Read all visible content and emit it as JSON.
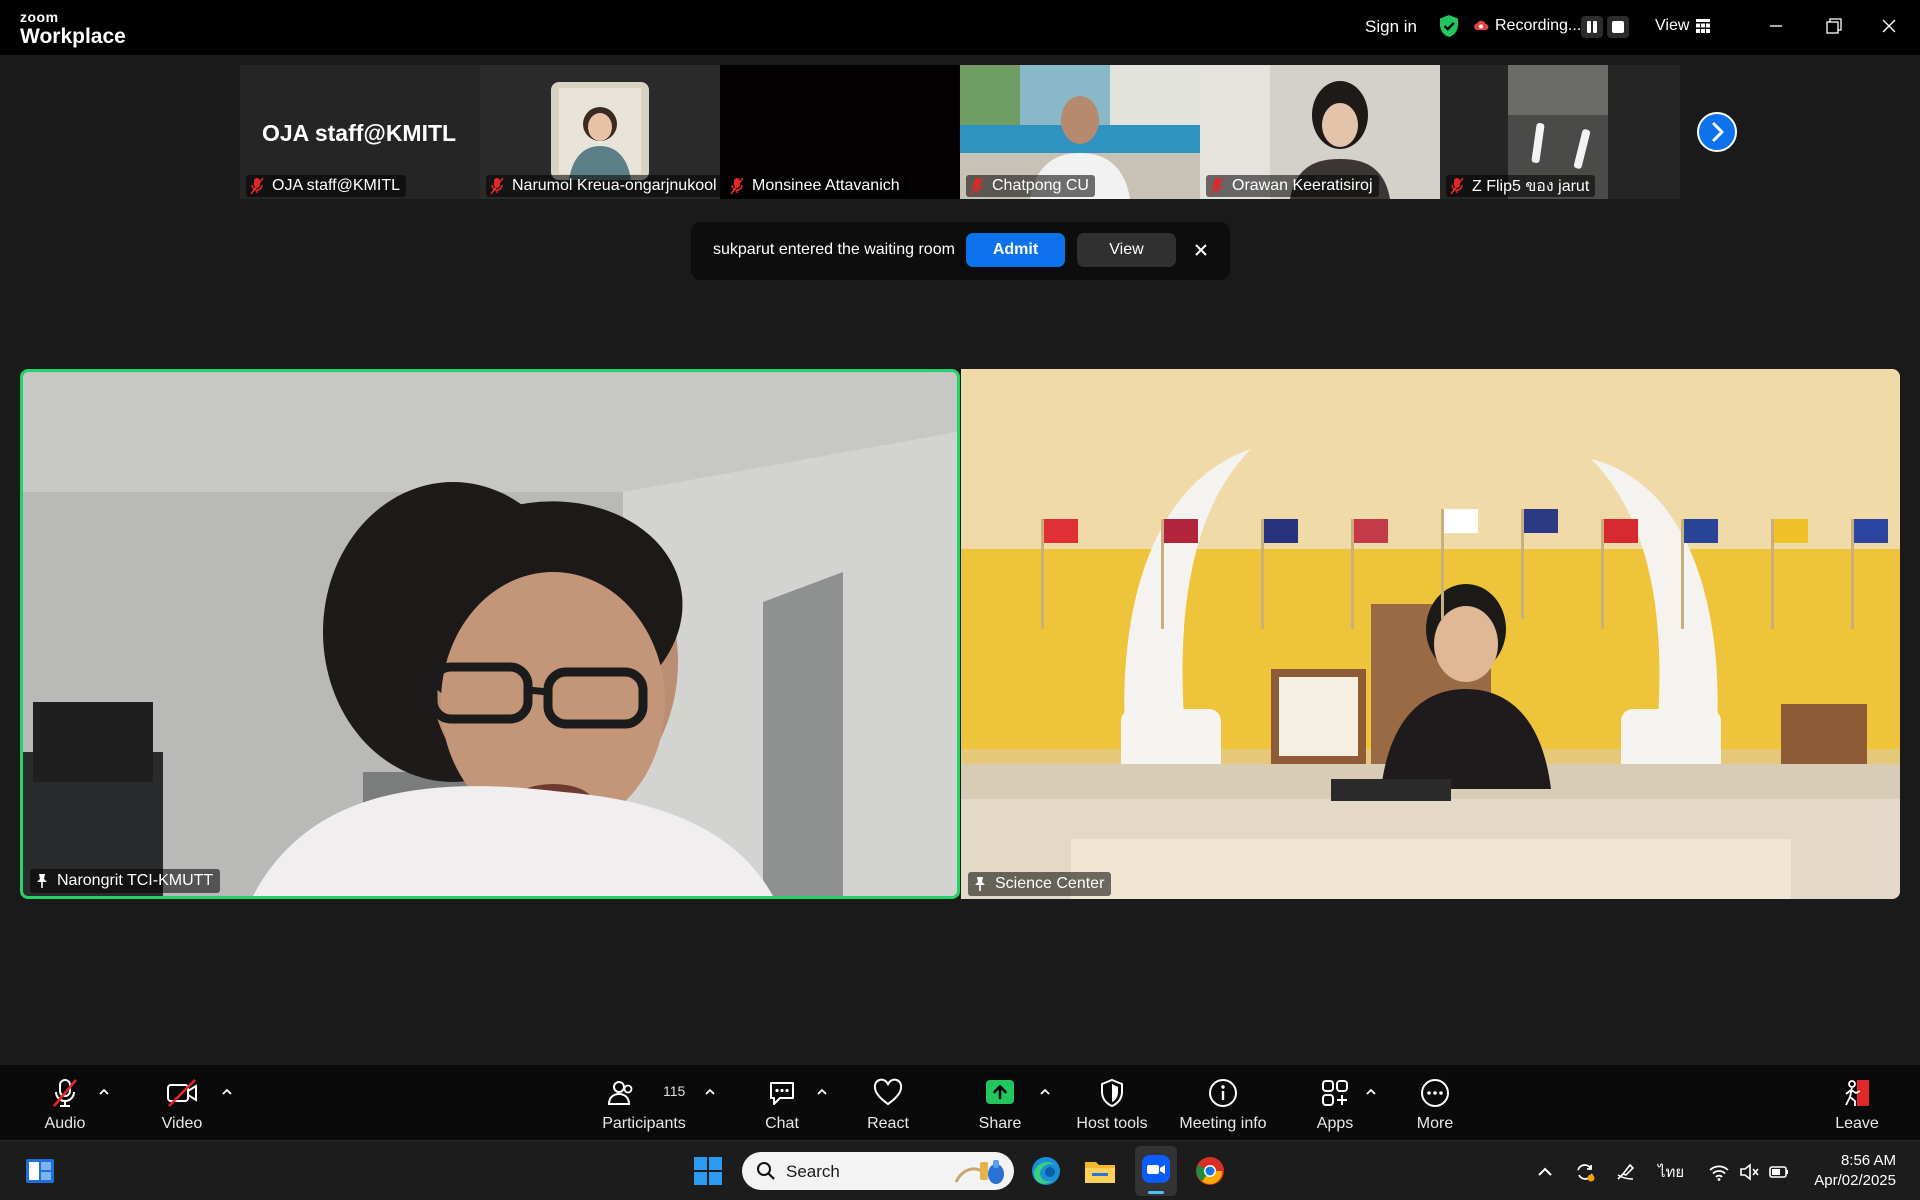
{
  "app": {
    "logo_top": "zoom",
    "logo_bottom": "Workplace",
    "sign_in": "Sign in",
    "recording_label": "Recording...",
    "view_label": "View"
  },
  "thumbnails": [
    {
      "name": "OJA staff@KMITL",
      "tile_text": "OJA staff@KMITL",
      "muted": true
    },
    {
      "name": "Narumol Kreua-ongarjnukool",
      "muted": true
    },
    {
      "name": "Monsinee Attavanich",
      "muted": true
    },
    {
      "name": "Chatpong CU",
      "muted": true
    },
    {
      "name": "Orawan Keeratisiroj",
      "muted": true
    },
    {
      "name": "Z Flip5 ของ jarut",
      "muted": true
    }
  ],
  "notification": {
    "text": "sukparut entered the waiting room",
    "admit_label": "Admit",
    "view_label": "View"
  },
  "main_videos": [
    {
      "name": "Narongrit TCI-KMUTT",
      "active_speaker": true
    },
    {
      "name": "Science Center",
      "active_speaker": false
    }
  ],
  "toolbar": {
    "audio": "Audio",
    "video": "Video",
    "participants": "Participants",
    "participants_count": "115",
    "chat": "Chat",
    "react": "React",
    "share": "Share",
    "host_tools": "Host tools",
    "meeting_info": "Meeting info",
    "apps": "Apps",
    "more": "More",
    "leave": "Leave"
  },
  "taskbar": {
    "search_placeholder": "Search",
    "language": "ไทย",
    "time": "8:56 AM",
    "date": "Apr/02/2025"
  },
  "colors": {
    "accent_blue": "#0e72ed",
    "active_speaker_border": "#22d36a",
    "share_green": "#22c55e",
    "muted_red": "#e02828",
    "leave_red": "#e02828"
  }
}
